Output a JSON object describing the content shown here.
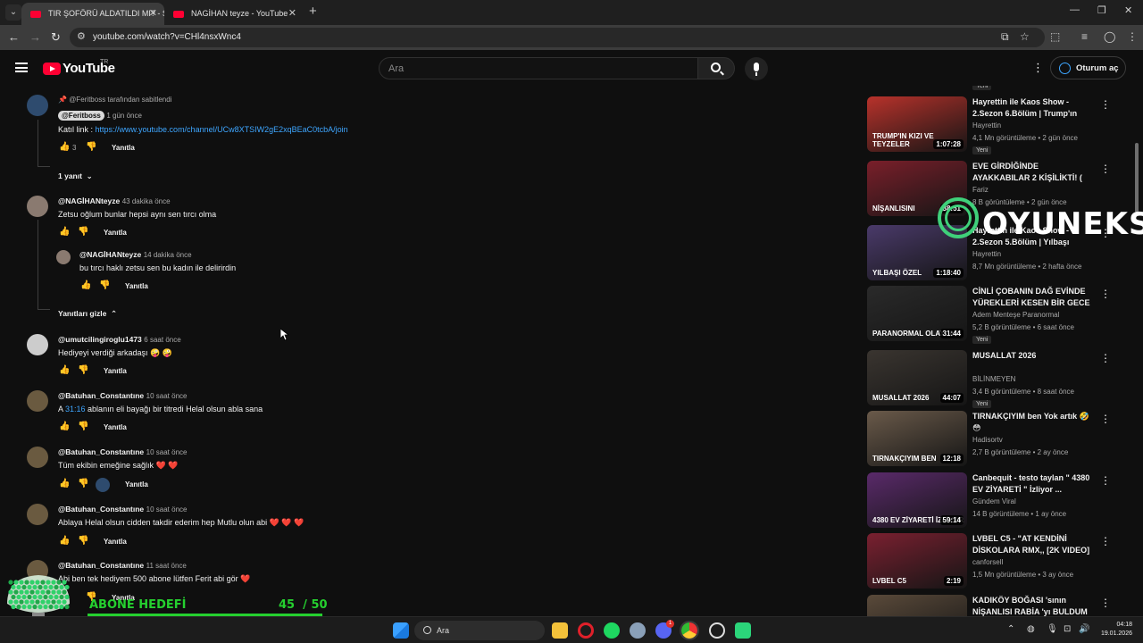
{
  "browser": {
    "tabs": [
      {
        "title": "TIR ŞOFÖRÜ ALDATILDI MI? - Sl",
        "active": true
      },
      {
        "title": "NAGİHAN teyze - YouTube",
        "active": false
      }
    ],
    "url": "youtube.com/watch?v=CHl4nsxWnc4"
  },
  "header": {
    "logo_text": "YouTube",
    "country": "TR",
    "search_placeholder": "Ara",
    "signin_label": "Oturum aç"
  },
  "comments": {
    "pinned": {
      "pinned_by": "@Feritboss tarafından sabitlendi",
      "author": "@Feritboss",
      "time": "1 gün önce",
      "text_prefix": "Katıl link : ",
      "link": "https://www.youtube.com/channel/UCw8XTSIW2gE2xqBEaC0tcbA/join",
      "likes": "3",
      "reply": "Yanıtla",
      "replies_toggle": "1 yanıt"
    },
    "c1": {
      "author": "@NAGİHANteyze",
      "time": "43 dakika önce",
      "text": "Zetsu oğlum  bunlar hepsi aynı  sen tırcı olma",
      "reply": "Yanıtla"
    },
    "c1r": {
      "author": "@NAGİHANteyze",
      "time": "14 dakika önce",
      "text": "bu tırcı haklı  zetsu sen bu kadın ile delirirdin",
      "reply": "Yanıtla"
    },
    "hide_replies": "Yanıtları gizle",
    "c2": {
      "author": "@umutcilingiroglu1473",
      "time": "6 saat önce",
      "text": "Hediyeyi verdiği arkadaşı 🤪 🤪",
      "reply": "Yanıtla"
    },
    "c3": {
      "author": "@Batuhan_Constantıne",
      "time": "10 saat önce",
      "text_prefix": "A ",
      "timestamp": "31:16",
      "text_suffix": "  ablanın eli bayağı bir titredi Helal olsun abla sana",
      "reply": "Yanıtla"
    },
    "c4": {
      "author": "@Batuhan_Constantıne",
      "time": "10 saat önce",
      "text": "Tüm ekibin emeğine sağlık ❤️ ❤️",
      "reply": "Yanıtla"
    },
    "c5": {
      "author": "@Batuhan_Constantıne",
      "time": "10 saat önce",
      "text": "Ablaya Helal olsun cidden takdir ederim hep Mutlu olun abi ❤️ ❤️ ❤️",
      "reply": "Yanıtla"
    },
    "c6": {
      "author": "@Batuhan_Constantıne",
      "time": "11 saat önce",
      "text": "Abi ben tek hediyem 500 abone lütfen Ferit abi gör ❤️",
      "reply": "Yanıtla"
    }
  },
  "recommendations": [
    {
      "title": "Hayrettin ile Kaos Show - 2.Sezon 6.Bölüm | Trump'ın Kı...",
      "channel": "Hayrettin",
      "meta": "4,1 Mn görüntüleme • 2 gün önce",
      "badge": "Yeni",
      "duration": "1:07:28",
      "thumb_text": "TRUMP'IN KIZI VE TEYZELER",
      "thumb_color": "#b8322b"
    },
    {
      "title": "EVE GİRDİĞİNDE AYAKKABILAR 2 KİŞİLİKTİ!  ( Sevgilini Test Et ...",
      "channel": "Fariz",
      "meta": "8 B görüntüleme • 2 gün önce",
      "badge": "",
      "duration": "38:51",
      "thumb_text": "NİŞANLISINI",
      "thumb_color": "#7a1f2a"
    },
    {
      "title": "Hayrettin ile Kaos Show - 2.Sezon 5.Bölüm | Yılbaşı Özel...",
      "channel": "Hayrettin",
      "meta": "8,7 Mn görüntüleme • 2 hafta önce",
      "badge": "",
      "duration": "1:18:40",
      "thumb_text": "YILBAŞI ÖZEL",
      "thumb_color": "#4a3a6a"
    },
    {
      "title": "CİNLİ ÇOBANIN DAĞ EVİNDE YÜREKLERİ KESEN BİR GECE -...",
      "channel": "Adem Menteşe Paranormal",
      "meta": "5,2 B görüntüleme • 6 saat önce",
      "badge": "Yeni",
      "duration": "31:44",
      "thumb_text": "PARANORMAL OLAYLAR",
      "thumb_color": "#2a2a2a"
    },
    {
      "title": "MUSALLAT  2026",
      "channel": "BİLİNMEYEN",
      "meta": "3,4 B görüntüleme • 8 saat önce",
      "badge": "Yeni",
      "duration": "44:07",
      "thumb_text": "MUSALLAT 2026",
      "thumb_color": "#3a3530"
    },
    {
      "title": "TIRNAKÇIYIM ben Yok artık 🤣 😳",
      "channel": "Hadisortv",
      "meta": "2,7 B görüntüleme • 2 ay önce",
      "badge": "",
      "duration": "12:18",
      "thumb_text": "TIRNAKÇIYIM BEN",
      "thumb_color": "#6a5a4a"
    },
    {
      "title": "Canbequit - testo taylan \" 4380 EV ZİYARETİ \" İzliyor ...",
      "channel": "Gündem Viral",
      "meta": "14 B görüntüleme • 1 ay önce",
      "badge": "",
      "duration": "59:14",
      "thumb_text": "4380 EV ZİYARETİ İZLİYOR",
      "thumb_color": "#5a2a6a"
    },
    {
      "title": "LVBEL C5 - \"AT KENDİNİ DİSKOLARA RMX,, [2K VIDEO] ...",
      "channel": "canforsell",
      "meta": "1,5 Mn görüntüleme • 3 ay önce",
      "badge": "",
      "duration": "2:19",
      "thumb_text": "LVBEL C5",
      "thumb_color": "#7a2030"
    },
    {
      "title": "KADIKÖY BOĞASI 'sının NİŞANLISI RABİA 'yı BULDUM ...",
      "channel": "",
      "meta": "",
      "badge": "",
      "duration": "",
      "thumb_text": "",
      "thumb_color": "#5a4a3a"
    }
  ],
  "overlay": {
    "brand": "OYUNEKS",
    "goal_title": "ABONE HEDEFİ",
    "goal_current": "45",
    "goal_sep": "/",
    "goal_target": "50",
    "goal_progress": 0.9
  },
  "taskbar": {
    "search_label": "Ara",
    "time": "04:18",
    "date": "19.01.2026",
    "discord_badge": "1"
  },
  "colors": {
    "accent_link": "#3ea6ff",
    "goal_green": "#25d02f",
    "youtube_red": "#ff0033"
  }
}
